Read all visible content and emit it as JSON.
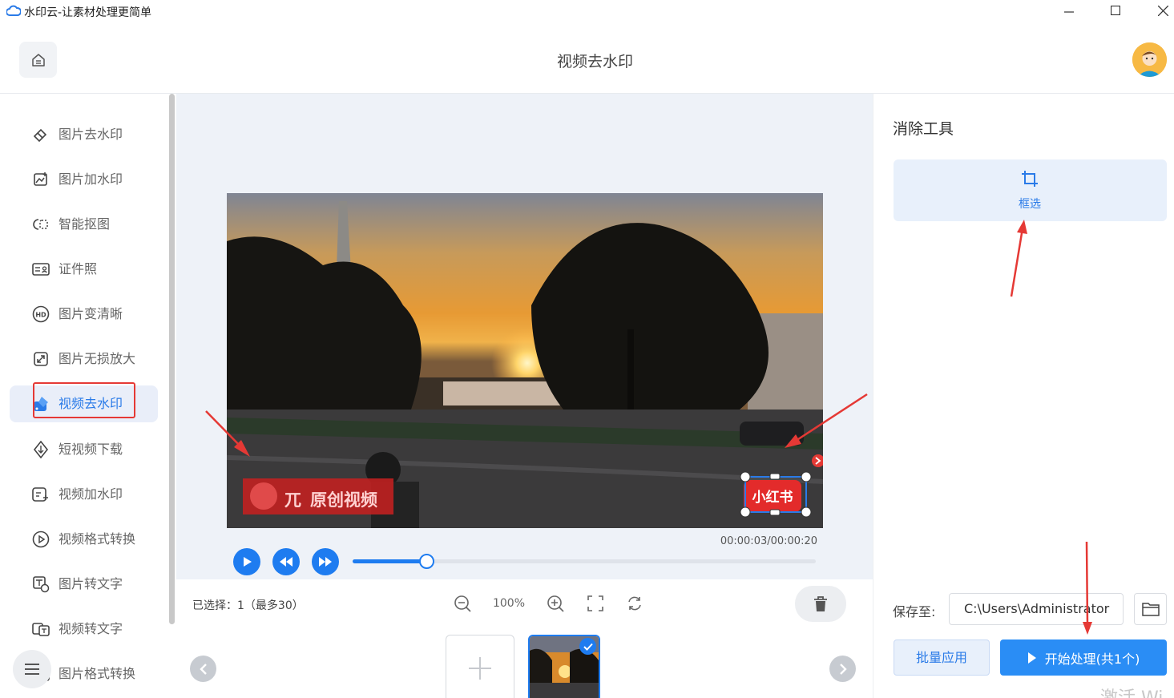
{
  "window": {
    "title": "水印云-让素材处理更简单"
  },
  "header": {
    "title": "视频去水印"
  },
  "sidebar": {
    "items": [
      {
        "label": "图片去水印",
        "icon": "eraser-icon"
      },
      {
        "label": "图片加水印",
        "icon": "image-add-icon"
      },
      {
        "label": "智能抠图",
        "icon": "cutout-icon"
      },
      {
        "label": "证件照",
        "icon": "id-card-icon"
      },
      {
        "label": "图片变清晰",
        "icon": "hd-icon"
      },
      {
        "label": "图片无损放大",
        "icon": "enlarge-icon"
      },
      {
        "label": "视频去水印",
        "icon": "video-eraser-icon",
        "active": true
      },
      {
        "label": "短视频下载",
        "icon": "download-icon"
      },
      {
        "label": "视频加水印",
        "icon": "video-add-icon"
      },
      {
        "label": "视频格式转换",
        "icon": "convert-icon"
      },
      {
        "label": "图片转文字",
        "icon": "ocr-icon"
      },
      {
        "label": "视频转文字",
        "icon": "video-text-icon"
      },
      {
        "label": "图片格式转换",
        "icon": "format-icon"
      }
    ]
  },
  "player": {
    "time": "00:00:03/00:00:20",
    "progress": 0.16,
    "watermark_left": "原创视频",
    "watermark_right": "小红书"
  },
  "toolbar": {
    "selected": "已选择：1（最多30）",
    "zoom": "100%"
  },
  "tools": {
    "title": "消除工具",
    "select_label": "框选"
  },
  "save": {
    "label": "保存至:",
    "path": "C:\\Users\\Administrator",
    "batch": "批量应用",
    "start": "开始处理(共1个)"
  },
  "overlay": {
    "activate": "激活 Wi"
  },
  "colors": {
    "accent": "#1e7cf0",
    "annotation": "#e53935"
  }
}
